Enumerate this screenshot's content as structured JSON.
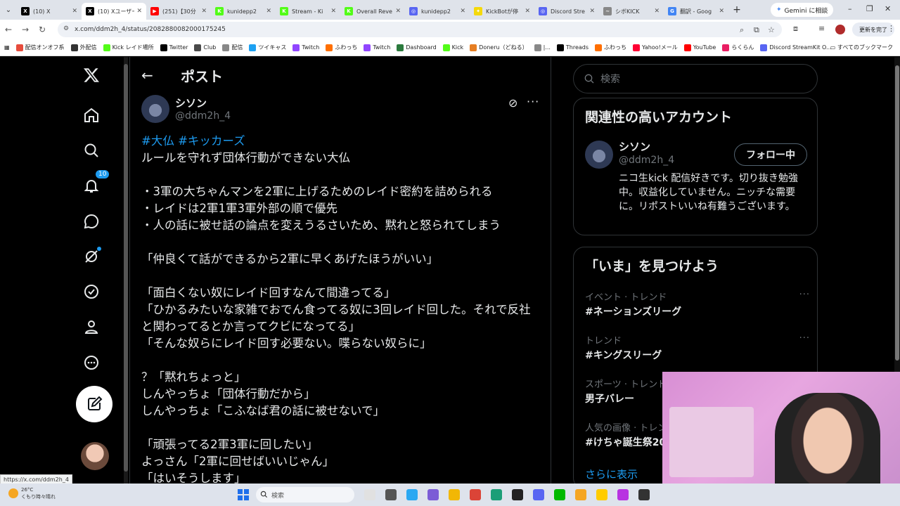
{
  "browser": {
    "tabs": [
      {
        "label": "(10) X",
        "color": "#000000",
        "glyph": "X"
      },
      {
        "label": "(10) Xユーザー",
        "color": "#000000",
        "glyph": "X",
        "active": true
      },
      {
        "label": "(251)【30分",
        "color": "#ff0000",
        "glyph": "▶"
      },
      {
        "label": "kunidepp2",
        "color": "#53fc18",
        "glyph": "K"
      },
      {
        "label": "Stream - Ki",
        "color": "#53fc18",
        "glyph": "K"
      },
      {
        "label": "Overall Reve",
        "color": "#53fc18",
        "glyph": "K"
      },
      {
        "label": "kunidepp2",
        "color": "#5865f2",
        "glyph": "◎"
      },
      {
        "label": "KickBotが停",
        "color": "#f5d90a",
        "glyph": "✦"
      },
      {
        "label": "Discord Stre",
        "color": "#5865f2",
        "glyph": "◎"
      },
      {
        "label": "シボKICK",
        "color": "#888888",
        "glyph": "~"
      },
      {
        "label": "翻訳 - Goog",
        "color": "#4285f4",
        "glyph": "G"
      }
    ],
    "gemini_label": "Gemini に相談",
    "url": "x.com/ddm2h_4/status/2082880082000175245",
    "update_label": "更新を完了",
    "bookmarks": [
      "配信オンオフ系",
      "外配信",
      "Kick レイド場所",
      "Twitter",
      "Club",
      "配信",
      "ツイキャス",
      "Twitch",
      "ふわっち",
      "Twitch",
      "Dashboard",
      "Kick",
      "Doneru（どねる）",
      "|...",
      "Threads",
      "ふわっち",
      "Yahoo!メール",
      "YouTube",
      "らくらん",
      "Discord StreamKit O..."
    ],
    "bookmarks_all": "すべてのブックマーク",
    "status_url": "https://x.com/ddm2h_4"
  },
  "nav": {
    "notifications_badge": "10"
  },
  "header": {
    "title": "ポスト"
  },
  "post": {
    "name": "シソン",
    "handle": "@ddm2h_4",
    "hashtags": "#大仏 #キッカーズ",
    "body": "ルールを守れず団体行動ができない大仏\n\n・3軍の大ちゃんマンを2軍に上げるためのレイド密約を詰められる\n・レイドは2軍1軍3軍外部の順で優先\n・人の話に被せ話の論点を変えうるさいため、黙れと怒られてしまう\n\n「仲良くて話ができるから2軍に早くあげたほうがいい」\n\n「面白くない奴にレイド回すなんて間違ってる」\n「ひかるみたいな家雑でおでん食ってる奴に3回レイド回した。それで反社と関わってるとか言ってクビになってる」\n「そんな奴らにレイド回す必要ない。喋らない奴らに」\n\n？「黙れちょっと」\nしんやっちょ「団体行動だから」\nしんやっちょ「こふなば君の話に被せないで」\n\n「頑張ってる2軍3軍に回したい」\nよっさん「2軍に回せばいいじゃん」\n「はいそうします」"
  },
  "right": {
    "search_placeholder": "検索",
    "related": {
      "title": "関連性の高いアカウント",
      "name": "シソン",
      "handle": "@ddm2h_4",
      "follow_label": "フォロー中",
      "bio": "ニコ生kick 配信好きです。切り抜き勉強中。収益化していません。ニッチな需要に。リポストいいね有難うございます。"
    },
    "trends": {
      "title": "「いま」を見つけよう",
      "items": [
        {
          "category": "イベント · トレンド",
          "name": "#ネーションズリーグ"
        },
        {
          "category": "トレンド",
          "name": "#キングスリーグ"
        },
        {
          "category": "スポーツ · トレンド",
          "name": "男子バレー"
        },
        {
          "category": "人気の画像 · トレンド",
          "name": "#けちゃ誕生祭20"
        }
      ],
      "show_more": "さらに表示"
    }
  },
  "taskbar": {
    "weather_temp": "26°C",
    "weather_desc": "くもり時々晴れ",
    "search_placeholder": "検索"
  }
}
